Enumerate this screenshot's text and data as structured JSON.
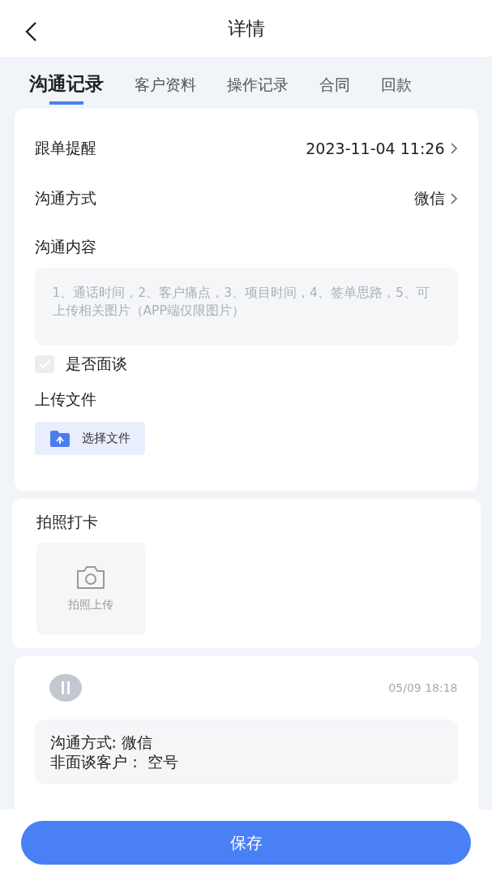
{
  "header": {
    "title": "详情"
  },
  "tabs": [
    {
      "label": "沟通记录",
      "selected": true
    },
    {
      "label": "客户资料",
      "selected": false
    },
    {
      "label": "操作记录",
      "selected": false
    },
    {
      "label": "合同",
      "selected": false
    },
    {
      "label": "回款",
      "selected": false
    }
  ],
  "form": {
    "rows": [
      {
        "label": "跟单提醒",
        "value": "2023-11-04 11:26"
      },
      {
        "label": "沟通方式",
        "value": "微信"
      }
    ],
    "content_label": "沟通内容",
    "content_placeholder": "1、通话时间，2、客户痛点，3、项目时间，4、签单思路，5、可上传相关图片（APP端仅限图片）",
    "face_to_face": {
      "label": "是否面谈",
      "checked": true,
      "disabled": true
    },
    "upload_label": "上传文件",
    "upload_button": "选择文件"
  },
  "photo": {
    "title": "拍照打卡",
    "button": "拍照上传"
  },
  "record": {
    "time": "05/09 18:18",
    "lines": [
      "沟通方式: 微信",
      "非面谈客户：  空号"
    ]
  },
  "footer": {
    "button": "保存"
  }
}
